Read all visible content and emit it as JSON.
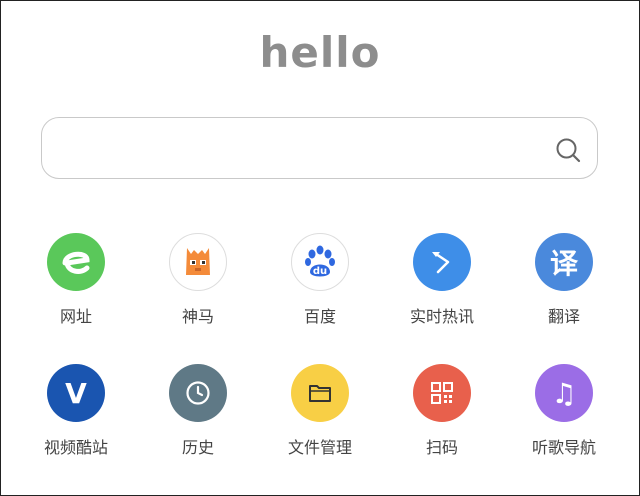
{
  "header": {
    "logo": "hello"
  },
  "search": {
    "value": "",
    "placeholder": ""
  },
  "shortcuts": [
    {
      "label": "网址",
      "icon": "e-browser-icon",
      "color": "#5ac85a"
    },
    {
      "label": "神马",
      "icon": "alpaca-icon",
      "color": "#f48b3a"
    },
    {
      "label": "百度",
      "icon": "baidu-paw-icon",
      "color": "#2f68e0"
    },
    {
      "label": "实时热讯",
      "icon": "arrow-icon",
      "color": "#3e8ee8"
    },
    {
      "label": "翻译",
      "icon": "translate-icon",
      "color": "#4a89dc",
      "glyph": "译"
    },
    {
      "label": "视频酷站",
      "icon": "v-icon",
      "color": "#1a55b0",
      "glyph": "V"
    },
    {
      "label": "历史",
      "icon": "clock-icon",
      "color": "#5f7986"
    },
    {
      "label": "文件管理",
      "icon": "folder-icon",
      "color": "#f8cf45"
    },
    {
      "label": "扫码",
      "icon": "qr-code-icon",
      "color": "#e8604c"
    },
    {
      "label": "听歌导航",
      "icon": "music-note-icon",
      "color": "#9b6de6",
      "glyph": "♫"
    }
  ]
}
